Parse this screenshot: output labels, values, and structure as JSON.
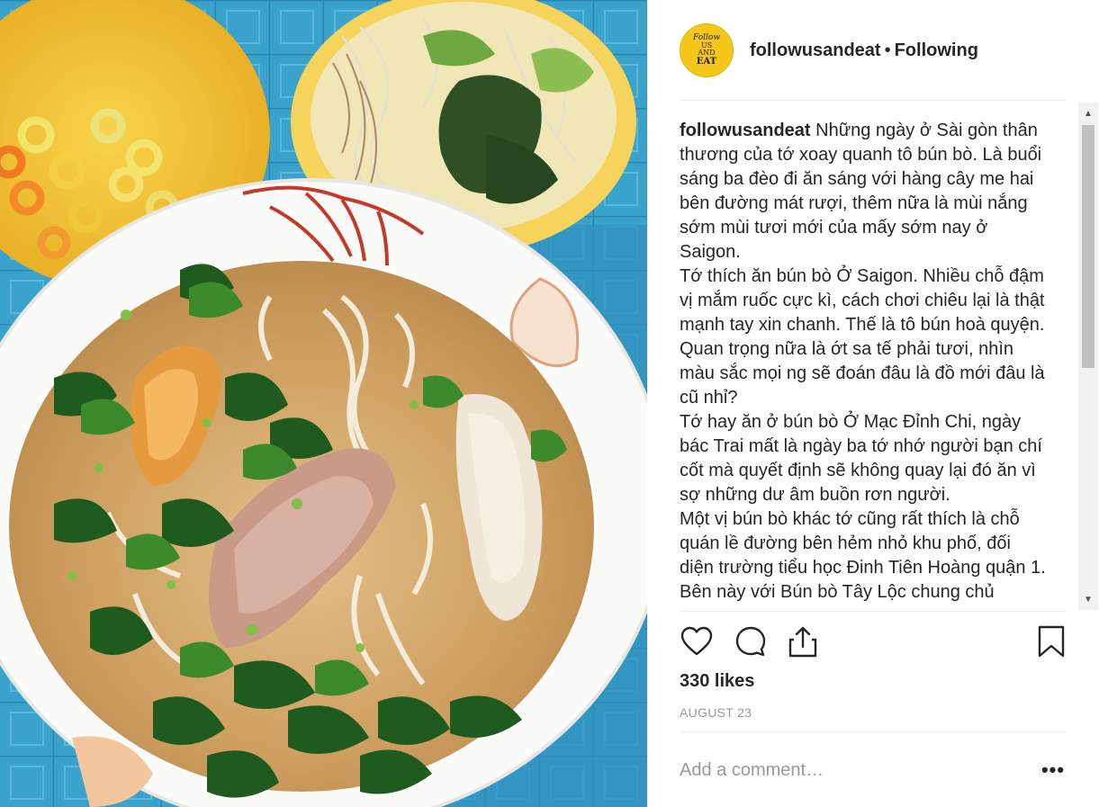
{
  "post": {
    "username": "followusandeat",
    "separator": "•",
    "follow_status": "Following",
    "avatar": {
      "line1": "Follow",
      "line2": "US",
      "line3": "AND",
      "line4": "EAT"
    },
    "caption": {
      "username": "followusandeat",
      "lines": [
        "Những ngày ở Sài gòn thân thương của tớ xoay quanh tô bún bò. Là buổi sáng ba đèo đi ăn sáng với hàng cây me hai bên đường mát rượi, thêm nữa là mùi nắng sớm mùi tươi mới của mấy sớm nay ở Saigon.",
        "Tớ thích ăn bún bò Ở Saigon. Nhiều chỗ đậm vị mắm ruốc cực kì, cách chơi chiêu lại là thật mạnh tay xin chanh. Thế là tô bún hoà quyện. Quan trọng nữa là ớt sa tế phải tươi, nhìn màu sắc mọi ng sẽ đoán đâu là đồ mới đâu là cũ nhỉ?",
        "Tớ hay ăn ở bún bò Ở Mạc Đỉnh Chi, ngày bác Trai mất là ngày ba tớ nhớ người bạn chí cốt mà quyết định sẽ không quay lại đó ăn vì sợ những dư âm buồn rơn người.",
        "Một vị bún bò khác tớ cũng rất thích là chỗ quán lề đường bên hẻm nhỏ khu phố, đối diện trường tiểu học Đinh Tiên Hoàng quận 1. Bên này với Bún bò Tây Lộc chung chủ"
      ]
    },
    "likes": "330 likes",
    "date": "AUGUST 23",
    "comment_placeholder": "Add a comment…",
    "more_label": "•••"
  },
  "icons": [
    "heart-icon",
    "comment-icon",
    "share-icon",
    "bookmark-icon"
  ],
  "colors": {
    "avatar_bg": "#f5c71a",
    "text": "#262626",
    "muted": "#999999",
    "divider": "#efefef"
  }
}
